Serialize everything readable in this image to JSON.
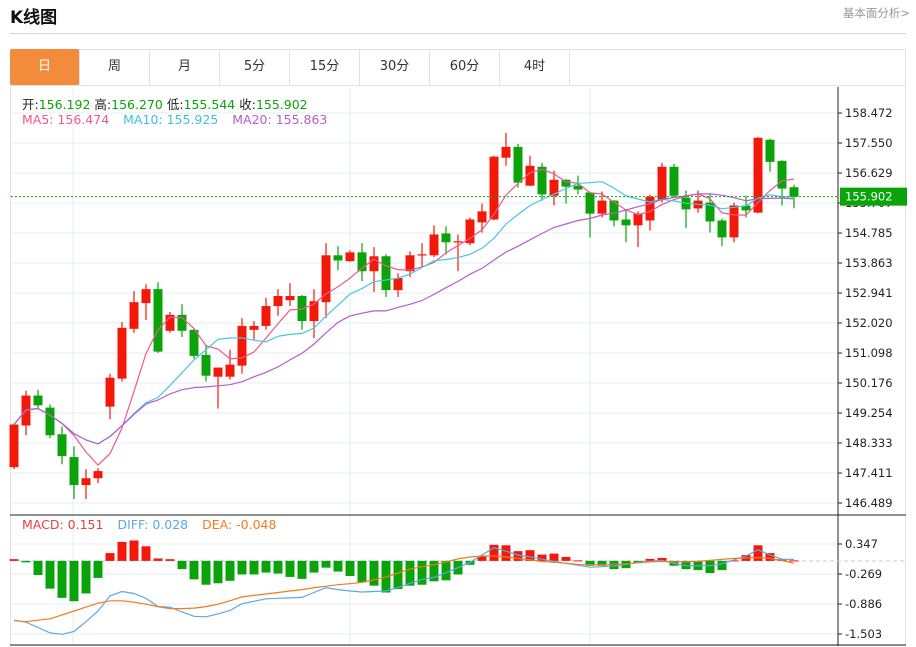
{
  "header": {
    "title": "K线图",
    "more_link": "基本面分析>"
  },
  "tabs": [
    {
      "label": "日",
      "active": true
    },
    {
      "label": "周"
    },
    {
      "label": "月"
    },
    {
      "label": "5分"
    },
    {
      "label": "15分"
    },
    {
      "label": "30分"
    },
    {
      "label": "60分"
    },
    {
      "label": "4时"
    }
  ],
  "ohlc_info": {
    "open_label": "开:",
    "open": "156.192",
    "high_label": "高:",
    "high": "156.270",
    "low_label": "低:",
    "low": "155.544",
    "close_label": "收:",
    "close": "155.902"
  },
  "ma_info": {
    "ma5": "MA5: 156.474",
    "ma10": "MA10: 155.925",
    "ma20": "MA20: 155.863"
  },
  "macd_info": {
    "macd": "MACD: 0.151",
    "diff": "DIFF: 0.028",
    "dea": "DEA: -0.048"
  },
  "colors": {
    "up": "#f2190a",
    "down": "#0aa30a",
    "ma5": "#ee5a8c",
    "ma10": "#44c8e0",
    "ma20": "#b65ec9",
    "diff": "#5aa8ea",
    "dea": "#f47a1e",
    "active_tab": "#f28c3c"
  },
  "chart_data": [
    {
      "type": "candlestick",
      "y_ticks": [
        "158.472",
        "157.550",
        "156.629",
        "155.707",
        "154.785",
        "153.863",
        "152.941",
        "152.020",
        "151.098",
        "150.176",
        "149.254",
        "148.333",
        "147.411",
        "146.489"
      ],
      "ylim": [
        146.489,
        158.472
      ],
      "current_price": "155.902",
      "grid": true,
      "moving_averages": [
        5,
        10,
        20
      ],
      "candles": [
        [
          147.59,
          148.93,
          147.53,
          148.9
        ],
        [
          148.87,
          149.94,
          148.57,
          149.79
        ],
        [
          149.79,
          149.97,
          149.39,
          149.49
        ],
        [
          149.42,
          149.52,
          148.48,
          148.57
        ],
        [
          148.6,
          148.84,
          147.68,
          147.93
        ],
        [
          147.9,
          148.23,
          146.61,
          147.04
        ],
        [
          147.04,
          147.53,
          146.61,
          147.25
        ],
        [
          147.25,
          147.56,
          147.1,
          147.47
        ],
        [
          149.45,
          150.46,
          149.06,
          150.34
        ],
        [
          150.31,
          152.05,
          150.22,
          151.87
        ],
        [
          151.84,
          153.0,
          151.72,
          152.66
        ],
        [
          152.63,
          153.21,
          152.11,
          153.06
        ],
        [
          153.06,
          153.27,
          151.1,
          151.14
        ],
        [
          151.78,
          152.36,
          151.72,
          152.27
        ],
        [
          152.27,
          152.6,
          151.59,
          151.78
        ],
        [
          151.81,
          151.84,
          150.92,
          151.01
        ],
        [
          151.04,
          151.35,
          150.22,
          150.4
        ],
        [
          150.37,
          150.65,
          149.39,
          150.65
        ],
        [
          150.37,
          151.2,
          150.28,
          150.74
        ],
        [
          150.71,
          152.17,
          150.46,
          151.93
        ],
        [
          151.81,
          152.08,
          151.5,
          151.93
        ],
        [
          151.93,
          152.79,
          151.81,
          152.54
        ],
        [
          152.54,
          153.06,
          152.24,
          152.85
        ],
        [
          152.72,
          153.24,
          152.54,
          152.85
        ],
        [
          152.85,
          152.88,
          151.81,
          152.08
        ],
        [
          152.08,
          153.06,
          151.56,
          152.69
        ],
        [
          152.66,
          154.47,
          152.17,
          154.1
        ],
        [
          154.1,
          154.38,
          153.64,
          153.94
        ],
        [
          153.92,
          154.25,
          153.9,
          154.19
        ],
        [
          154.19,
          154.47,
          153.31,
          153.61
        ],
        [
          153.61,
          154.35,
          152.97,
          154.07
        ],
        [
          154.07,
          154.13,
          152.82,
          153.03
        ],
        [
          153.03,
          153.55,
          152.82,
          153.4
        ],
        [
          153.61,
          154.22,
          153.43,
          154.1
        ],
        [
          154.1,
          154.47,
          153.76,
          154.13
        ],
        [
          154.1,
          155.02,
          154.04,
          154.74
        ],
        [
          154.77,
          154.99,
          154.13,
          154.5
        ],
        [
          154.5,
          154.74,
          153.61,
          154.53
        ],
        [
          154.47,
          155.26,
          154.41,
          155.2
        ],
        [
          155.11,
          155.69,
          154.8,
          155.45
        ],
        [
          155.2,
          157.16,
          155.18,
          157.13
        ],
        [
          157.1,
          157.86,
          156.85,
          157.43
        ],
        [
          157.43,
          157.52,
          156.18,
          156.33
        ],
        [
          156.24,
          157.16,
          156.22,
          156.85
        ],
        [
          156.82,
          156.94,
          155.78,
          155.97
        ],
        [
          155.93,
          156.7,
          155.63,
          156.42
        ],
        [
          156.42,
          156.44,
          155.69,
          156.21
        ],
        [
          156.24,
          156.55,
          155.97,
          156.12
        ],
        [
          156.03,
          156.05,
          154.65,
          155.38
        ],
        [
          155.38,
          156.06,
          155.26,
          155.78
        ],
        [
          155.78,
          155.8,
          154.99,
          155.17
        ],
        [
          155.2,
          155.51,
          154.5,
          155.02
        ],
        [
          155.02,
          155.45,
          154.35,
          155.38
        ],
        [
          155.17,
          155.97,
          154.86,
          155.9
        ],
        [
          155.81,
          156.94,
          155.72,
          156.82
        ],
        [
          156.82,
          156.91,
          155.87,
          155.93
        ],
        [
          155.87,
          156.09,
          154.93,
          155.51
        ],
        [
          155.54,
          156.09,
          155.41,
          155.78
        ],
        [
          155.72,
          155.97,
          154.8,
          155.14
        ],
        [
          155.17,
          155.23,
          154.38,
          154.65
        ],
        [
          154.65,
          155.72,
          154.5,
          155.63
        ],
        [
          155.63,
          155.93,
          155.26,
          155.48
        ],
        [
          155.41,
          157.74,
          155.39,
          157.71
        ],
        [
          157.65,
          157.68,
          156.67,
          156.97
        ],
        [
          157.0,
          157.02,
          155.63,
          156.15
        ],
        [
          156.192,
          156.27,
          155.544,
          155.902
        ]
      ]
    },
    {
      "type": "bar+line",
      "y_ticks": [
        "0.347",
        "-0.269",
        "-0.886",
        "-1.503"
      ],
      "ylim": [
        -1.503,
        0.347
      ],
      "macd": [
        0.035,
        -0.03,
        -0.29,
        -0.57,
        -0.76,
        -0.83,
        -0.67,
        -0.35,
        0.16,
        0.39,
        0.42,
        0.3,
        0.05,
        0.035,
        -0.17,
        -0.38,
        -0.49,
        -0.46,
        -0.41,
        -0.28,
        -0.28,
        -0.24,
        -0.26,
        -0.33,
        -0.37,
        -0.24,
        -0.14,
        -0.22,
        -0.31,
        -0.44,
        -0.51,
        -0.65,
        -0.58,
        -0.51,
        -0.49,
        -0.42,
        -0.4,
        -0.28,
        -0.08,
        0.1,
        0.33,
        0.32,
        0.2,
        0.22,
        0.13,
        0.15,
        0.08,
        0.01,
        -0.1,
        -0.1,
        -0.17,
        -0.15,
        -0.04,
        0.04,
        0.06,
        -0.1,
        -0.17,
        -0.19,
        -0.25,
        -0.19,
        0.01,
        0.12,
        0.32,
        0.16,
        0.035,
        0.01
      ],
      "diff": [
        -1.22,
        -1.26,
        -1.37,
        -1.48,
        -1.51,
        -1.45,
        -1.25,
        -1.03,
        -0.72,
        -0.63,
        -0.67,
        -0.77,
        -0.94,
        -0.95,
        -1.05,
        -1.14,
        -1.15,
        -1.09,
        -1.02,
        -0.88,
        -0.83,
        -0.78,
        -0.77,
        -0.76,
        -0.75,
        -0.65,
        -0.55,
        -0.59,
        -0.62,
        -0.64,
        -0.63,
        -0.62,
        -0.55,
        -0.46,
        -0.38,
        -0.34,
        -0.24,
        -0.14,
        -0.03,
        0.12,
        0.27,
        0.2,
        0.12,
        0.08,
        0.035,
        -0.01,
        -0.05,
        -0.09,
        -0.13,
        -0.12,
        -0.11,
        -0.07,
        -0.03,
        -0.01,
        0.01,
        -0.05,
        -0.1,
        -0.1,
        -0.1,
        -0.06,
        0.02,
        0.1,
        0.23,
        0.12,
        0.035,
        0.028
      ],
      "dea": [
        -1.23,
        -1.25,
        -1.22,
        -1.19,
        -1.11,
        -1.03,
        -0.95,
        -0.87,
        -0.82,
        -0.82,
        -0.85,
        -0.89,
        -0.94,
        -0.98,
        -0.98,
        -0.97,
        -0.94,
        -0.89,
        -0.82,
        -0.74,
        -0.71,
        -0.68,
        -0.65,
        -0.62,
        -0.59,
        -0.55,
        -0.52,
        -0.49,
        -0.47,
        -0.44,
        -0.39,
        -0.33,
        -0.25,
        -0.17,
        -0.12,
        -0.08,
        -0.02,
        0.04,
        0.08,
        0.1,
        0.1,
        0.08,
        0.05,
        0.02,
        -0.01,
        -0.03,
        -0.05,
        -0.07,
        -0.08,
        -0.08,
        -0.07,
        -0.06,
        -0.04,
        -0.02,
        -0.01,
        -0.02,
        -0.02,
        -0.01,
        0.01,
        0.03,
        0.05,
        0.06,
        0.07,
        0.05,
        0.01,
        -0.048
      ]
    }
  ]
}
